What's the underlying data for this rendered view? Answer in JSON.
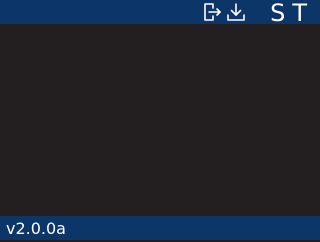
{
  "header": {
    "icons": [
      "logout-icon",
      "download-icon"
    ],
    "brand": "ST"
  },
  "footer": {
    "version": "v2.0.0a"
  },
  "colors": {
    "bar": "#0c3568",
    "background": "#231f20",
    "foreground": "#ffffff"
  }
}
